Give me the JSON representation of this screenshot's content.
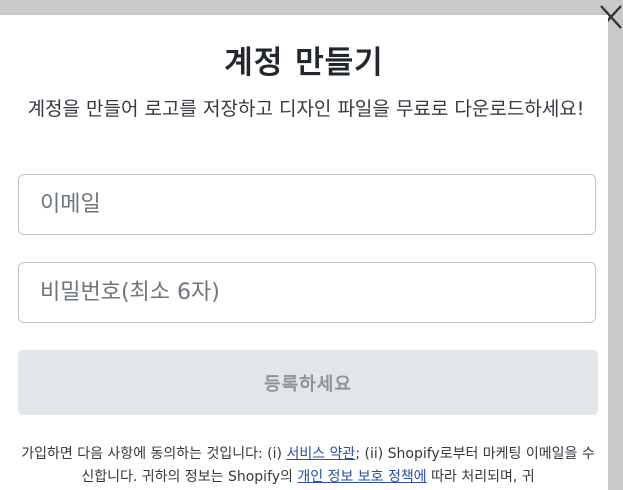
{
  "modal": {
    "close_icon": "close-x-icon",
    "title": "계정 만들기",
    "subtitle": "계정을 만들어 로고를 저장하고 디자인 파일을 무료로 다운로드하세요!",
    "email_placeholder": "이메일",
    "password_placeholder": "비밀번호(최소 6자)",
    "submit_label": "등록하세요",
    "terms": {
      "prefix": "가입하면 다음 사항에 동의하는 것입니다: (i) ",
      "tos_link": "서비스 약관",
      "middle": "; (ii) Shopify로부터 마케팅 이메일을 수신합니다. 귀하의 정보는 Shopify의 ",
      "privacy_link": "개인 정보 보호 정책에",
      "suffix": " 따라 처리되며, 귀"
    }
  },
  "colors": {
    "overlay": "#c9c9c9",
    "button_bg": "#e2e6ea",
    "link": "#2d4ea8"
  }
}
